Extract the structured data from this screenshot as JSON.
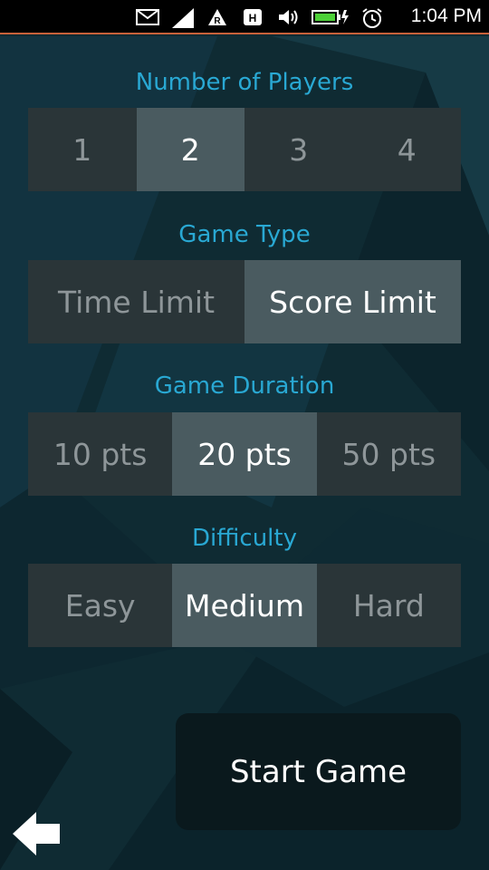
{
  "status_bar": {
    "time": "1:04 PM",
    "icons": [
      "mail-icon",
      "signal-icon",
      "roaming-r-icon",
      "h-network-icon",
      "volume-icon",
      "battery-charging-icon",
      "alarm-icon"
    ]
  },
  "players": {
    "title": "Number of Players",
    "options": [
      "1",
      "2",
      "3",
      "4"
    ],
    "selected": "2"
  },
  "game_type": {
    "title": "Game Type",
    "options": [
      "Time Limit",
      "Score Limit"
    ],
    "selected": "Score Limit"
  },
  "duration": {
    "title": "Game Duration",
    "options": [
      "10 pts",
      "20 pts",
      "50 pts"
    ],
    "selected": "20 pts"
  },
  "difficulty": {
    "title": "Difficulty",
    "options": [
      "Easy",
      "Medium",
      "Hard"
    ],
    "selected": "Medium"
  },
  "start_button": {
    "label": "Start Game"
  },
  "back_button": {
    "icon": "back-arrow-icon"
  },
  "colors": {
    "background": "#0f2b33",
    "accent": "#29a8d3",
    "segment_bg": "#2a3538",
    "segment_selected_bg": "#4a5b60",
    "button_bg": "#0a191d",
    "status_line": "#c8613a"
  }
}
